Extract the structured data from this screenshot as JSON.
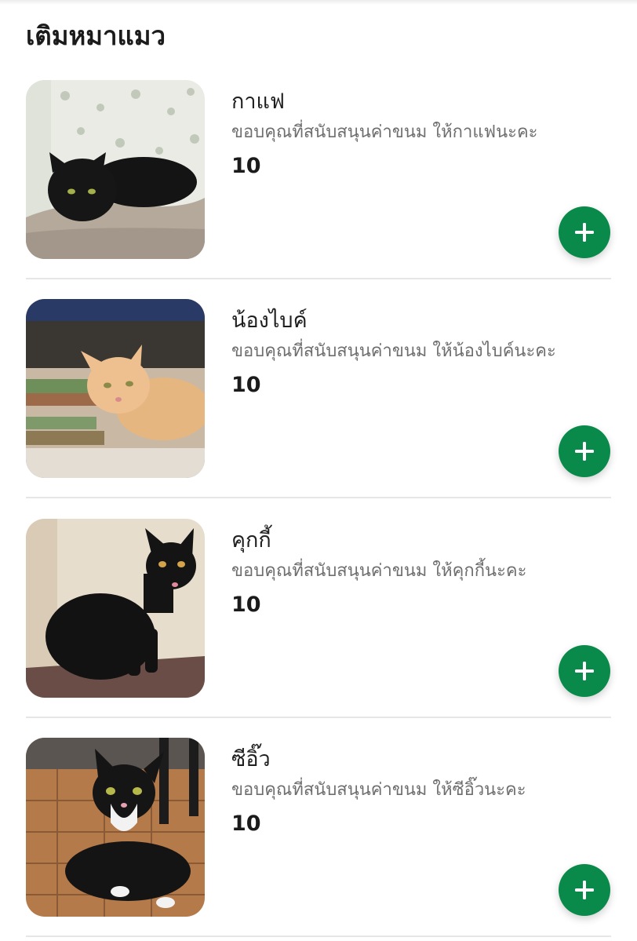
{
  "section": {
    "title": "เติมหมาแมว"
  },
  "items": [
    {
      "name": "กาแฟ",
      "desc": "ขอบคุณที่สนับสนุนค่าขนม ให้กาแฟนะคะ",
      "price": "10",
      "photo": "black-cat-on-cushion"
    },
    {
      "name": "น้องไบค์",
      "desc": "ขอบคุณที่สนับสนุนค่าขนม ให้น้องไบค์นะคะ",
      "price": "10",
      "photo": "orange-cat-on-books"
    },
    {
      "name": "คุกกี้",
      "desc": "ขอบคุณที่สนับสนุนค่าขนม ให้คุกกี้นะคะ",
      "price": "10",
      "photo": "black-cat-sitting"
    },
    {
      "name": "ซีอิ๊ว",
      "desc": "ขอบคุณที่สนับสนุนค่าขนม ให้ซีอิ๊วนะคะ",
      "price": "10",
      "photo": "tuxedo-cat-on-tiles"
    }
  ],
  "colors": {
    "accent": "#0a8a4a",
    "text": "#1b1b1b",
    "muted": "#6e6e6e",
    "divider": "#e6e6e6"
  },
  "icons": {
    "add": "plus-icon"
  }
}
